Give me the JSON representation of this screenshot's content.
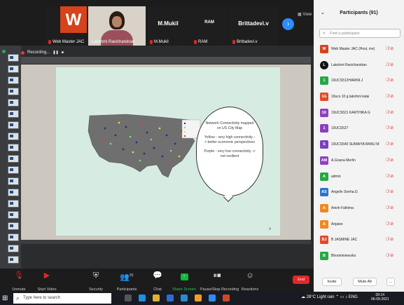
{
  "gallery": {
    "tiles": [
      {
        "name": "Web Master JAC",
        "logo": "W"
      },
      {
        "name": "Lakshmi Ravichandran"
      },
      {
        "bigname": "M.Mukil",
        "name": "M.Mukil"
      },
      {
        "bigname": "RAM",
        "name": "RAM"
      },
      {
        "bigname": "Brittadevi.v",
        "name": "Brittadevi.v"
      }
    ],
    "view_label": "View",
    "next_icon": "chevron-right-icon"
  },
  "recording": {
    "label": "Recording..."
  },
  "slide": {
    "bubble_title": "Network Connectivity mapped on US City Map",
    "bubble_yellow": "Yellow - very high connectivity -> better economic perspectives",
    "bubble_purple": "Purple - very low connectivity -> not resilient",
    "slide_number": "4"
  },
  "controls": {
    "unmute": "Unmute",
    "start_video": "Start Video",
    "security": "Security",
    "participants": "Participants",
    "participants_count": "91",
    "chat": "Chat",
    "share_screen": "Share Screen",
    "pause_recording": "Pause/Stop Recording",
    "reactions": "Reactions",
    "end": "End"
  },
  "panel": {
    "title": "Participants (91)",
    "search_placeholder": "Find a participant",
    "participants": [
      {
        "initials": "W",
        "name": "Web Master JAC (Host, me)",
        "color": "#d4431c"
      },
      {
        "initials": "L",
        "name": "Lakshmi Ravichandran",
        "color": "#111111"
      },
      {
        "initials": "1",
        "name": "19UCS512HARINI.J",
        "color": "#27a844"
      },
      {
        "initials": "1G",
        "name": "19ucs 10 g.lakshmi kalai",
        "color": "#e24a2a"
      },
      {
        "initials": "1K",
        "name": "19UCS521 KARTHIKA G",
        "color": "#8f3fbf"
      },
      {
        "initials": "1",
        "name": "19UCS527",
        "color": "#8f3fbf"
      },
      {
        "initials": "S",
        "name": "19UCS540 SUMAIYA BANU M",
        "color": "#7b3fbf"
      },
      {
        "initials": "AM",
        "name": "A.Gnana Merlin",
        "color": "#8f3fbf"
      },
      {
        "initials": "A",
        "name": "admin",
        "color": "#27a844"
      },
      {
        "initials": "AS",
        "name": "Angelin Sneha.G",
        "color": "#2a74c8"
      },
      {
        "initials": "A",
        "name": "Anish Fathima",
        "color": "#f08a1e"
      },
      {
        "initials": "A",
        "name": "Anjaiee",
        "color": "#f08a1e"
      },
      {
        "initials": "BJ",
        "name": "B JASMINE JAC",
        "color": "#e24a2a"
      },
      {
        "initials": "B",
        "name": "Bhoominewsrks",
        "color": "#27a844"
      }
    ],
    "invite": "Invite",
    "mute_all": "Mute All",
    "more": "..."
  },
  "taskbar": {
    "search_placeholder": "Type here to search",
    "weather": "28°C Light rain",
    "lang": "ENG",
    "time": "09:14",
    "date": "06-09-2021"
  }
}
